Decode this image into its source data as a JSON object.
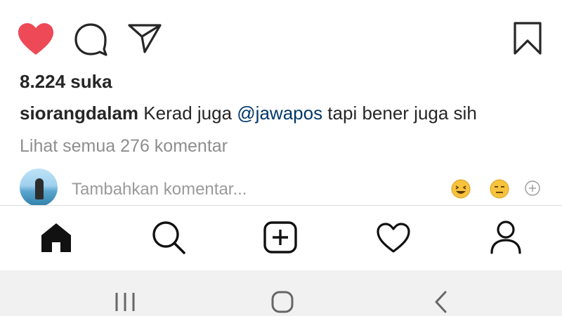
{
  "post": {
    "likes_text": "8.224 suka",
    "caption_user": "siorangdalam",
    "caption_text_before": " Kerad juga ",
    "caption_mention": "@jawapos",
    "caption_text_after": " tapi bener juga sih",
    "view_comments_text": "Lihat semua 276 komentar",
    "liked": true
  },
  "comment": {
    "placeholder": "Tambahkan komentar..."
  },
  "icons": {
    "like": "heart-icon",
    "comment": "comment-icon",
    "share": "send-icon",
    "save": "bookmark-icon",
    "quick_emoji_1": "laughing-emoji-icon",
    "quick_emoji_2": "expressionless-emoji-icon",
    "add_emoji": "add-circle-icon",
    "nav_home": "home-icon",
    "nav_search": "search-icon",
    "nav_create": "add-square-icon",
    "nav_activity": "heart-icon",
    "nav_profile": "profile-icon",
    "sys_recent": "recent-apps-icon",
    "sys_home": "home-button-icon",
    "sys_back": "back-icon"
  },
  "colors": {
    "like_red": "#ed4956",
    "mention_blue": "#00376b",
    "secondary_gray": "#8e8e8e",
    "text_dark": "#262626"
  }
}
